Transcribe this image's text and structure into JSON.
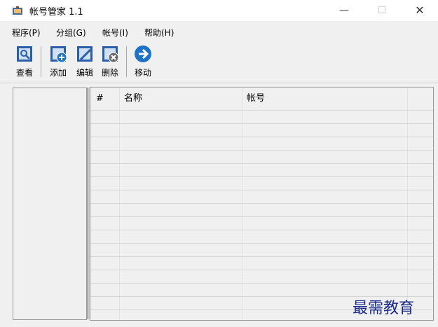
{
  "window": {
    "title": "帐号管家 1.1",
    "min_glyph": "—",
    "max_glyph": "☐",
    "close_glyph": "✕"
  },
  "menu": [
    "程序(P)",
    "分组(G)",
    "帐号(I)",
    "帮助(H)"
  ],
  "toolbar": {
    "view": "查看",
    "add": "添加",
    "edit": "编辑",
    "delete": "删除",
    "move": "移动"
  },
  "table": {
    "columns": [
      "#",
      "名称",
      "帐号"
    ]
  },
  "watermark": "最需教育",
  "colors": {
    "icon_blue": "#2a5ea8",
    "move_blue": "#1f73c6"
  }
}
